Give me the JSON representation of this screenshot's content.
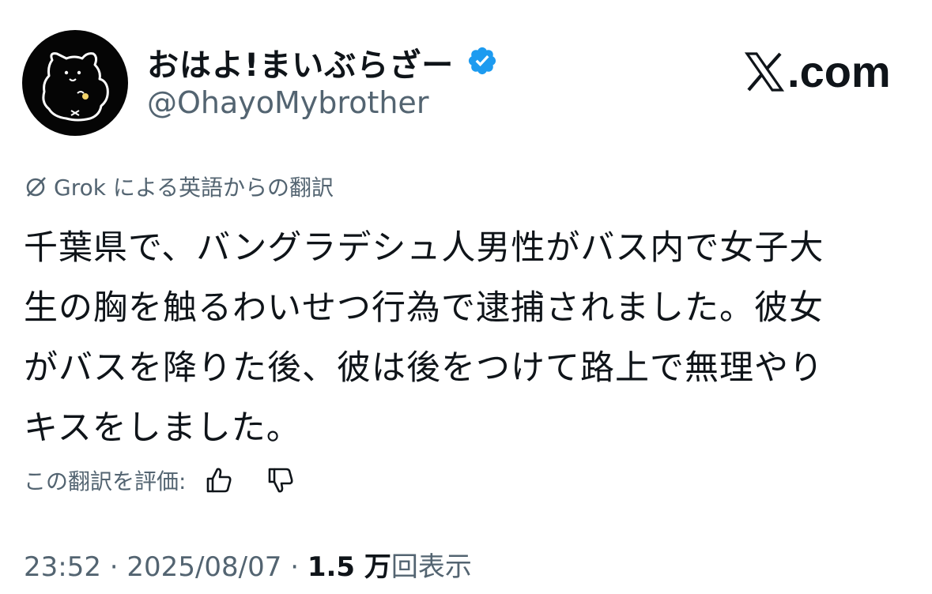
{
  "header": {
    "display_name": "おはよ!まいぶらざー",
    "handle": "@OhayoMybrother",
    "brand": "com",
    "brand_dot": "."
  },
  "translation": {
    "note": "Grok による英語からの翻訳"
  },
  "tweet": {
    "lines": [
      "千葉県で、バングラデシュ人男性がバス内で女子大",
      "生の胸を触るわいせつ行為で逮捕されました。彼女",
      "がバスを降りた後、彼は後をつけて路上で無理やり",
      "キスをしました。"
    ]
  },
  "rating": {
    "label": "この翻訳を評価:"
  },
  "meta": {
    "time": "23:52",
    "separator": " · ",
    "date": "2025/08/07",
    "views_count": "1.5 万",
    "views_label": "回表示"
  },
  "colors": {
    "text": "#0f1419",
    "secondary": "#536471",
    "verified": "#1d9bf0",
    "avatar_bg": "#050505"
  },
  "icons": {
    "verified": "verified-badge-icon",
    "brand": "x-logo-icon",
    "translate": "grok-translate-icon",
    "thumbs_up": "thumbs-up-icon",
    "thumbs_down": "thumbs-down-icon"
  }
}
